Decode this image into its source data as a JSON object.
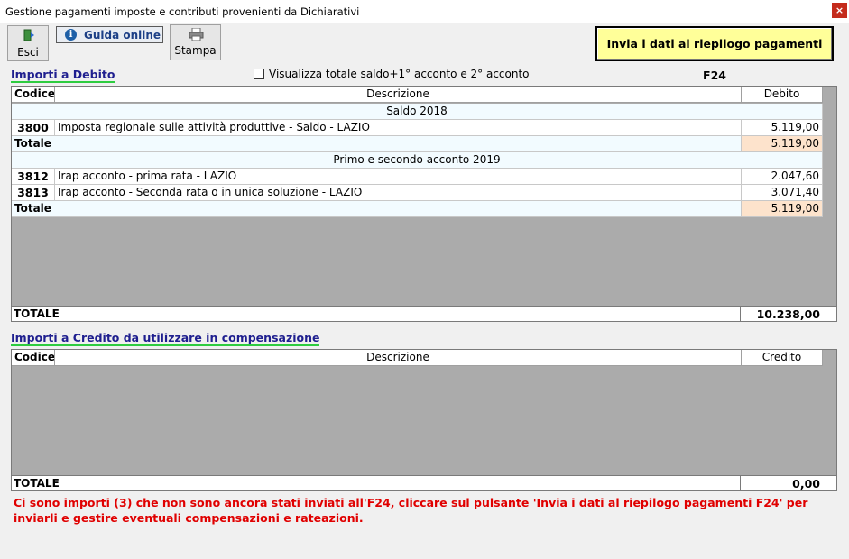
{
  "window": {
    "title": "Gestione pagamenti imposte e contributi provenienti da Dichiarativi",
    "close_glyph": "×"
  },
  "toolbar": {
    "esci_label": "Esci",
    "guida_label": "Guida online",
    "guida_icon_glyph": "i",
    "stampa_label": "Stampa",
    "invia_label": "Invia i dati al riepilogo pagamenti F24"
  },
  "debito": {
    "title": "Importi a Debito",
    "checkbox_label": "Visualizza totale saldo+1° acconto e 2° acconto",
    "checkbox_checked": false,
    "columns": {
      "codice": "Codice",
      "descrizione": "Descrizione",
      "importo": "Debito"
    },
    "groups": [
      {
        "label": "Saldo 2018",
        "rows": [
          {
            "code": "3800",
            "desc": "Imposta regionale sulle attività produttive - Saldo - LAZIO",
            "amount": "5.119,00"
          }
        ],
        "total_label": "Totale",
        "total": "5.119,00"
      },
      {
        "label": "Primo e secondo acconto 2019",
        "rows": [
          {
            "code": "3812",
            "desc": "Irap acconto - prima rata - LAZIO",
            "amount": "2.047,60"
          },
          {
            "code": "3813",
            "desc": "Irap acconto - Seconda rata o in unica soluzione - LAZIO",
            "amount": "3.071,40"
          }
        ],
        "total_label": "Totale",
        "total": "5.119,00"
      }
    ],
    "grand_total_label": "TOTALE",
    "grand_total": "10.238,00"
  },
  "credito": {
    "title": "Importi a Credito da utilizzare in compensazione",
    "columns": {
      "codice": "Codice",
      "descrizione": "Descrizione",
      "importo": "Credito"
    },
    "grand_total_label": "TOTALE",
    "grand_total": "0,00"
  },
  "message": "Ci sono importi (3) che non sono ancora stati inviati all'F24, cliccare sul pulsante 'Invia i dati al riepilogo pagamenti F24' per inviarli e gestire eventuali compensazioni e rateazioni.",
  "colors": {
    "accent_underline": "#2ecc40",
    "section_title": "#1f1f8f",
    "total_amount_bg": "#fde3cc",
    "group_bg": "#f2fbff",
    "invia_bg": "#ffff99",
    "message": "#e00000"
  }
}
